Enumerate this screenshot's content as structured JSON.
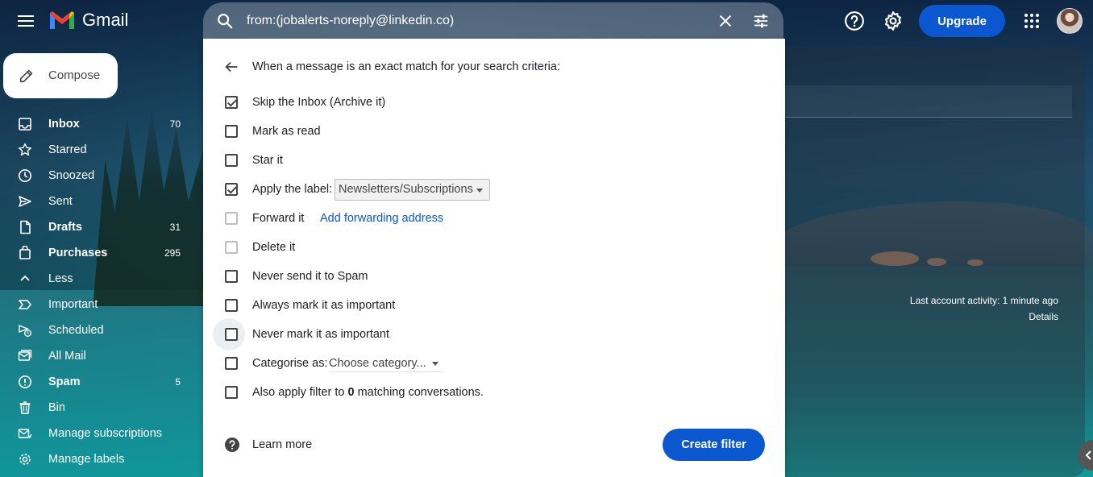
{
  "app": {
    "logo_text": "Gmail"
  },
  "search": {
    "value": "from:(jobalerts-noreply@linkedin.co)"
  },
  "header": {
    "upgrade_label": "Upgrade"
  },
  "compose": {
    "label": "Compose"
  },
  "sidebar": {
    "items": [
      {
        "label": "Inbox",
        "count": "70",
        "bold": true,
        "icon": "inbox-icon"
      },
      {
        "label": "Starred",
        "count": "",
        "bold": false,
        "icon": "star-icon"
      },
      {
        "label": "Snoozed",
        "count": "",
        "bold": false,
        "icon": "clock-icon"
      },
      {
        "label": "Sent",
        "count": "",
        "bold": false,
        "icon": "send-icon"
      },
      {
        "label": "Drafts",
        "count": "31",
        "bold": true,
        "icon": "draft-icon"
      },
      {
        "label": "Purchases",
        "count": "295",
        "bold": true,
        "icon": "shopping-bag-icon"
      },
      {
        "label": "Less",
        "count": "",
        "bold": false,
        "icon": "chevron-up-icon"
      },
      {
        "label": "Important",
        "count": "",
        "bold": false,
        "icon": "label-important-icon"
      },
      {
        "label": "Scheduled",
        "count": "",
        "bold": false,
        "icon": "scheduled-send-icon"
      },
      {
        "label": "All Mail",
        "count": "",
        "bold": false,
        "icon": "all-mail-icon"
      },
      {
        "label": "Spam",
        "count": "5",
        "bold": true,
        "icon": "spam-icon"
      },
      {
        "label": "Bin",
        "count": "",
        "bold": false,
        "icon": "trash-icon"
      },
      {
        "label": "Manage subscriptions",
        "count": "",
        "bold": false,
        "icon": "subscriptions-icon"
      },
      {
        "label": "Manage labels",
        "count": "",
        "bold": false,
        "icon": "gear-icon"
      }
    ]
  },
  "dialog": {
    "heading": "When a message is an exact match for your search criteria:",
    "options": {
      "skip_inbox": {
        "label": "Skip the Inbox (Archive it)",
        "checked": true
      },
      "mark_read": {
        "label": "Mark as read",
        "checked": false
      },
      "star": {
        "label": "Star it",
        "checked": false
      },
      "apply_label": {
        "label": "Apply the label:",
        "checked": true,
        "selected": "Newsletters/Subscriptions"
      },
      "forward": {
        "label": "Forward it",
        "checked": false,
        "link": "Add forwarding address"
      },
      "delete": {
        "label": "Delete it",
        "checked": false
      },
      "never_spam": {
        "label": "Never send it to Spam",
        "checked": false
      },
      "always_important": {
        "label": "Always mark it as important",
        "checked": false
      },
      "never_important": {
        "label": "Never mark it as important",
        "checked": false
      },
      "categorise": {
        "label": "Categorise as:",
        "checked": false,
        "selected": "Choose category..."
      },
      "also_apply": {
        "prefix": "Also apply filter to ",
        "count": "0",
        "suffix": " matching conversations.",
        "checked": false
      }
    },
    "learn_more": "Learn more",
    "create_filter": "Create filter"
  },
  "account": {
    "activity": "Last account activity: 1 minute ago",
    "details": "Details"
  },
  "colors": {
    "primary_blue": "#0b57d0",
    "dialog_bg": "#ffffff"
  }
}
